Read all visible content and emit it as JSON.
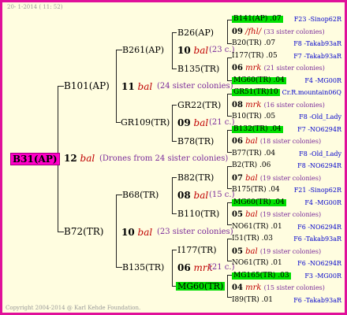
{
  "header": {
    "date": "20-  1-2014 ( 11: 52)"
  },
  "root": {
    "id": "B31(AP)",
    "num": "12",
    "mark": "bal",
    "note": "(Drones from 24 sister colonies)"
  },
  "l1": [
    {
      "id": "B101(AP)",
      "num": "11",
      "mark": "bal",
      "note": "(24 sister colonies)"
    },
    {
      "id": "B72(TR)",
      "num": "10",
      "mark": "bal",
      "note": "(23 sister colonies)"
    }
  ],
  "l2": [
    {
      "id": "B261(AP)"
    },
    {
      "id": "GR109(TR)",
      "num": "09",
      "mark": "bal",
      "note": "(21 c.)"
    },
    {
      "id": "B68(TR)",
      "num": "08",
      "mark": "bal",
      "note": "(15 c.)"
    },
    {
      "id": "B135(TR)",
      "num": "06",
      "mark": "mrk",
      "note": "(21 c.)"
    }
  ],
  "l3": [
    {
      "id": "B26(AP)",
      "num": "10",
      "mark": "bal",
      "note": "(23 c.)"
    },
    {
      "id": "B135(TR)"
    },
    {
      "id": "GR22(TR)",
      "num": "08",
      "mark": "bal",
      "note": "(21 c.)"
    },
    {
      "id": "B78(TR)"
    },
    {
      "id": "B82(TR)",
      "num": "08",
      "mark": "bal",
      "note": "(15 c.)"
    },
    {
      "id": "B110(TR)"
    },
    {
      "id": "I177(TR)",
      "num": "06",
      "mark": "mrk",
      "note": "(21 c.)"
    },
    {
      "id": "MG60(TR)"
    }
  ],
  "l4": [
    {
      "id": "B141(AP) .07",
      "right": "F23 -Sinop62R"
    },
    {
      "id": "09",
      "mark": "/fhl/",
      "note": "(33 sister colonies)"
    },
    {
      "id": "B20(TR) .07",
      "right": "F8 -Takab93aR"
    },
    {
      "id": "I177(TR) .05",
      "right": "F7 -Takab93aR"
    },
    {
      "id": "06",
      "mark": "mrk",
      "note": "(21 sister colonies)"
    },
    {
      "id": "MG60(TR) .04",
      "right": "F4 -MG00R"
    },
    {
      "id": "GR51(TR)10",
      "right": "Cr.R.mountain06Q"
    },
    {
      "id": "08",
      "mark": "mrk",
      "note": "(16 sister colonies)"
    },
    {
      "id": "B10(TR) .05",
      "right": "F8 -Old_Lady"
    },
    {
      "id": "B132(TR) .04",
      "right": "F7 -NO6294R"
    },
    {
      "id": "06",
      "mark": "bal",
      "note": "(18 sister colonies)"
    },
    {
      "id": "B77(TR) .04",
      "right": "F8 -Old_Lady"
    },
    {
      "id": "B2(TR) .06",
      "right": "F8 -NO6294R"
    },
    {
      "id": "07",
      "mark": "bal",
      "note": "(19 sister colonies)"
    },
    {
      "id": "B175(TR) .04",
      "right": "F21 -Sinop62R"
    },
    {
      "id": "MG60(TR) .04",
      "right": "F4 -MG00R"
    },
    {
      "id": "05",
      "mark": "bal",
      "note": "(19 sister colonies)"
    },
    {
      "id": "NO61(TR) .01",
      "right": "F6 -NO6294R"
    },
    {
      "id": "I51(TR) .03",
      "right": "F6 -Takab93aR"
    },
    {
      "id": "05",
      "mark": "bal",
      "note": "(19 sister colonies)"
    },
    {
      "id": "NO61(TR) .01",
      "right": "F6 -NO6294R"
    },
    {
      "id": "MG165(TR) .03",
      "right": "F3 -MG00R"
    },
    {
      "id": "04",
      "mark": "mrk",
      "note": "(15 sister colonies)"
    },
    {
      "id": "I89(TR) .01",
      "right": "F6 -Takab93aR"
    }
  ],
  "footer": {
    "copyright": "Copyright 2004-2014 @ Karl Kehde Foundation."
  }
}
